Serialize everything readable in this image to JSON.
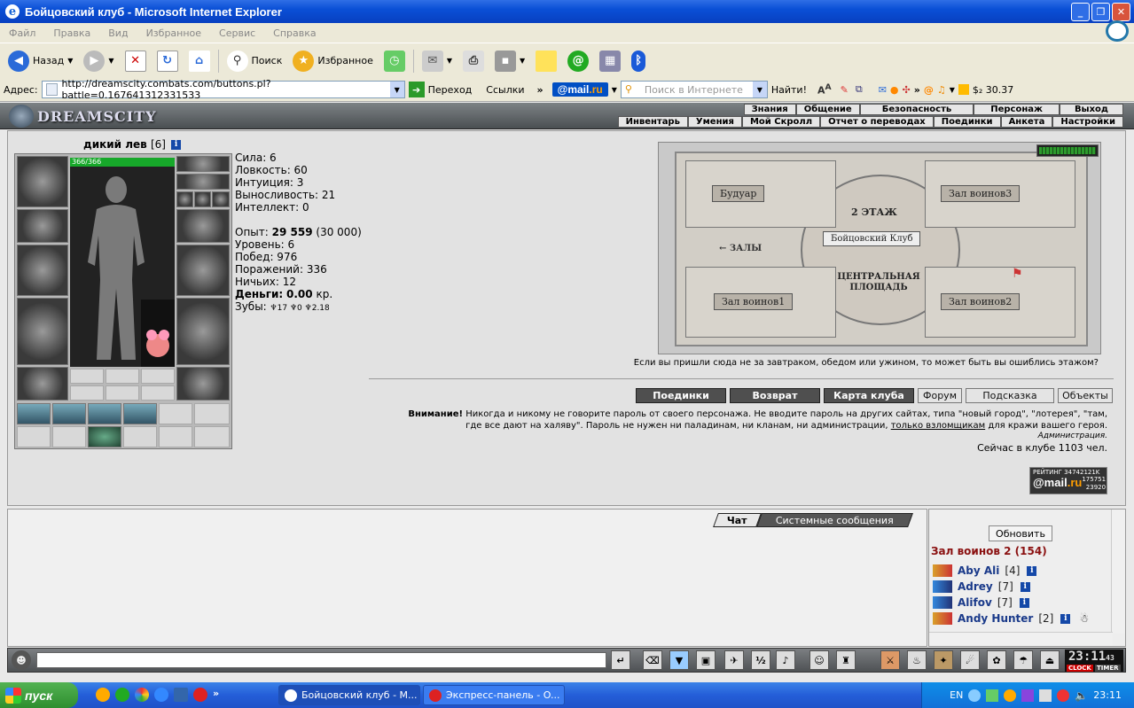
{
  "window": {
    "title": "Бойцовский клуб - Microsoft Internet Explorer"
  },
  "menubar": [
    "Файл",
    "Правка",
    "Вид",
    "Избранное",
    "Сервис",
    "Справка"
  ],
  "toolbar": {
    "back": "Назад",
    "search": "Поиск",
    "favorites": "Избранное"
  },
  "address": {
    "label": "Адрес:",
    "url": "http://dreamscity.combats.com/buttons.pl?battle=0.167641312331533",
    "go": "Переход",
    "links": "Ссылки",
    "search_placeholder": "Поиск в Интернете",
    "find": "Найти!",
    "mailru_a": "@mail",
    "mailru_b": ".ru",
    "balance": "$₂ 30.37"
  },
  "game": {
    "logo": "DREAMSCITY",
    "menu_top": [
      "Знания",
      "Общение",
      "Безопасность",
      "Персонаж",
      "Выход"
    ],
    "menu_bottom": [
      "Инвентарь",
      "Умения",
      "Мой Скролл",
      "Отчет о переводах",
      "Поединки",
      "Анкета",
      "Настройки"
    ],
    "character": {
      "name": "дикий лев",
      "level": "[6]",
      "hp": "366/366"
    },
    "stats": {
      "strength": "Сила: 6",
      "agility": "Ловкость: 60",
      "intuition": "Интуиция: 3",
      "endurance": "Выносливость: 21",
      "intellect": "Интеллект: 0",
      "exp_label": "Опыт:",
      "exp_value": "29 559",
      "exp_next": "(30 000)",
      "level": "Уровень: 6",
      "wins": "Побед: 976",
      "losses": "Поражений: 336",
      "draws": "Ничьих: 12",
      "money_label": "Деньги:",
      "money_value": "0.00",
      "money_unit": "кр.",
      "teeth_label": "Зубы:",
      "teeth_1": "17",
      "teeth_2": "0",
      "teeth_3": "2.18"
    },
    "map": {
      "floor": "2 ЭТАЖ",
      "club": "Бойцовский Клуб",
      "boudoir": "Будуар",
      "hall3": "Зал воинов3",
      "halls": "ЗАЛЫ",
      "square": "ЦЕНТРАЛЬНАЯ ПЛОЩАДЬ",
      "hall1": "Зал воинов1",
      "hall2": "Зал воинов2",
      "caption": "Если вы пришли сюда не за завтраком, обедом или ужином, то может быть вы ошиблись этажом?"
    },
    "buttons": [
      "Поединки",
      "Возврат",
      "Карта клуба",
      "Форум",
      "Подсказка",
      "Объекты"
    ],
    "warning": {
      "bold": "Внимание!",
      "text1": " Никогда и никому не говорите пароль от своего персонажа. Не вводите пароль на других сайтах, типа \"новый город\", \"лотерея\", \"там, где все дают на халяву\". Пароль не нужен ни паладинам, ни кланам, ни администрации, ",
      "link": "только взломщикам",
      "text2": " для кражи вашего героя.",
      "admin": "Администрация.",
      "online": "Сейчас в клубе 1103 чел."
    },
    "rating": {
      "label": "РЕЙТИНГ",
      "id": "34742121K",
      "a": "@mail",
      "b": ".ru",
      "n1": "175751",
      "n2": "23920"
    },
    "chat_tabs": [
      "Чат",
      "Системные сообщения"
    ],
    "users": {
      "refresh": "Обновить",
      "room": "Зал воинов 2 (154)",
      "list": [
        {
          "name": "Aby Ali",
          "level": "[4]"
        },
        {
          "name": "Adrey",
          "level": "[7]"
        },
        {
          "name": "Alifov",
          "level": "[7]"
        },
        {
          "name": "Andy Hunter",
          "level": "[2]"
        }
      ]
    },
    "clock": {
      "time": "23:11",
      "sec": "43",
      "label1": "CLOCK",
      "label2": "TIMER"
    }
  },
  "taskbar": {
    "start": "пуск",
    "tasks": [
      "Бойцовский клуб - M...",
      "Экспресс-панель - O..."
    ],
    "lang": "EN",
    "time": "23:11"
  }
}
